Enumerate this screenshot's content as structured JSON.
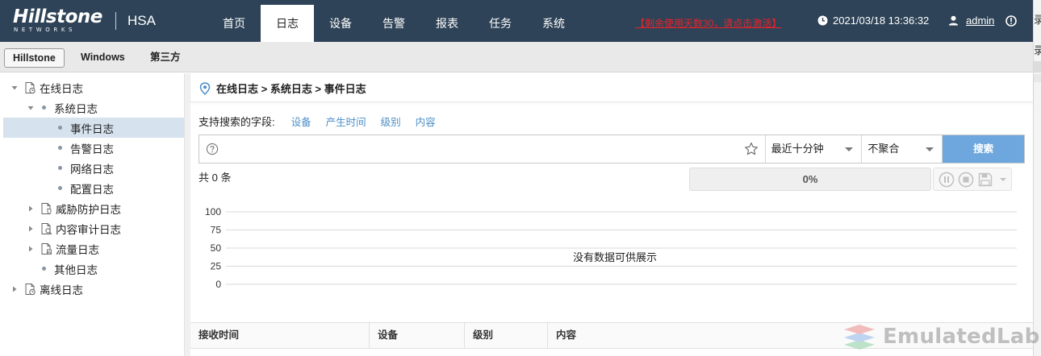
{
  "brand": {
    "logo_main": "Hillstone",
    "logo_sub": "NETWORKS",
    "product": "HSA"
  },
  "nav": {
    "tabs": [
      {
        "label": "首页",
        "active": false
      },
      {
        "label": "日志",
        "active": true
      },
      {
        "label": "设备",
        "active": false
      },
      {
        "label": "告警",
        "active": false
      },
      {
        "label": "报表",
        "active": false
      },
      {
        "label": "任务",
        "active": false
      },
      {
        "label": "系统",
        "active": false
      }
    ]
  },
  "header": {
    "license_notice": "【剩余使用天数30，请点击激活】",
    "datetime": "2021/03/18 13:36:32",
    "username": "admin"
  },
  "vendor_tabs": [
    {
      "label": "Hillstone",
      "active": true
    },
    {
      "label": "Windows",
      "active": false
    },
    {
      "label": "第三方",
      "active": false
    }
  ],
  "tree": {
    "items": [
      {
        "label": "在线日志",
        "level": 0,
        "state": "expanded",
        "icon": "folder-doc-icon"
      },
      {
        "label": "系统日志",
        "level": 1,
        "state": "expanded",
        "icon": "bullet"
      },
      {
        "label": "事件日志",
        "level": 2,
        "state": "leaf",
        "icon": "bullet",
        "selected": true
      },
      {
        "label": "告警日志",
        "level": 2,
        "state": "leaf",
        "icon": "bullet"
      },
      {
        "label": "网络日志",
        "level": 2,
        "state": "leaf",
        "icon": "bullet"
      },
      {
        "label": "配置日志",
        "level": 2,
        "state": "leaf",
        "icon": "bullet"
      },
      {
        "label": "威胁防护日志",
        "level": 1,
        "state": "collapsed",
        "icon": "shield-doc-icon"
      },
      {
        "label": "内容审计日志",
        "level": 1,
        "state": "collapsed",
        "icon": "search-doc-icon"
      },
      {
        "label": "流量日志",
        "level": 1,
        "state": "collapsed",
        "icon": "chart-doc-icon"
      },
      {
        "label": "其他日志",
        "level": 1,
        "state": "leaf",
        "icon": "bullet"
      },
      {
        "label": "离线日志",
        "level": 0,
        "state": "collapsed",
        "icon": "folder-doc-icon"
      }
    ]
  },
  "main": {
    "breadcrumb": "在线日志 > 系统日志 > 事件日志",
    "search_fields_label": "支持搜索的字段:",
    "search_fields": [
      "设备",
      "产生时间",
      "级别",
      "内容"
    ],
    "search": {
      "value": "",
      "placeholder": "",
      "time_range": "最近十分钟",
      "aggregation": "不聚合",
      "button_label": "搜索"
    },
    "total_text": "共 0 条",
    "progress": {
      "percent": 0,
      "label": "0%"
    },
    "table_columns": [
      "接收时间",
      "设备",
      "级别",
      "内容"
    ]
  },
  "chart_data": {
    "type": "bar",
    "categories": [],
    "series": [],
    "yticks": [
      100,
      75,
      50,
      25,
      0
    ],
    "ylim": [
      0,
      100
    ],
    "empty_message": "没有数据可供展示"
  },
  "watermark": "EmulatedLab",
  "edge": {
    "chars": [
      "录",
      "录"
    ]
  },
  "colors": {
    "topbar": "#2e4357",
    "accent": "#6da7de",
    "link": "#4b8ec7",
    "notice": "#e8232a",
    "selected_row": "#d6e3ee"
  }
}
